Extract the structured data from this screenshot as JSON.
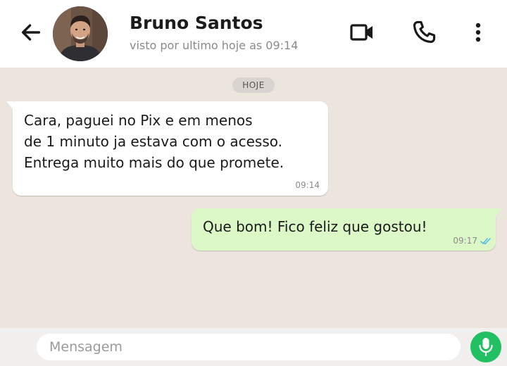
{
  "header": {
    "contact_name": "Bruno Santos",
    "status": "visto por ultimo hoje as 09:14",
    "icons": [
      "back-arrow-icon",
      "video-call-icon",
      "phone-icon",
      "more-options-icon"
    ]
  },
  "chat": {
    "date_divider": "HOJE",
    "messages": [
      {
        "direction": "incoming",
        "lines": [
          "Cara, paguei no Pix e em menos",
          "de 1 minuto ja estava com o acesso.",
          "Entrega muito mais do que promete."
        ],
        "time": "09:14"
      },
      {
        "direction": "outgoing",
        "text": "Que bom! Fico feliz que gostou!",
        "time": "09:17",
        "status": "read"
      }
    ]
  },
  "composer": {
    "placeholder": "Mensagem",
    "value": ""
  },
  "colors": {
    "chat_background": "#ece5dd",
    "outgoing_bubble": "#dcf8c6",
    "incoming_bubble": "#ffffff",
    "accent": "#21c063",
    "read_ticks": "#4fb6ec"
  }
}
